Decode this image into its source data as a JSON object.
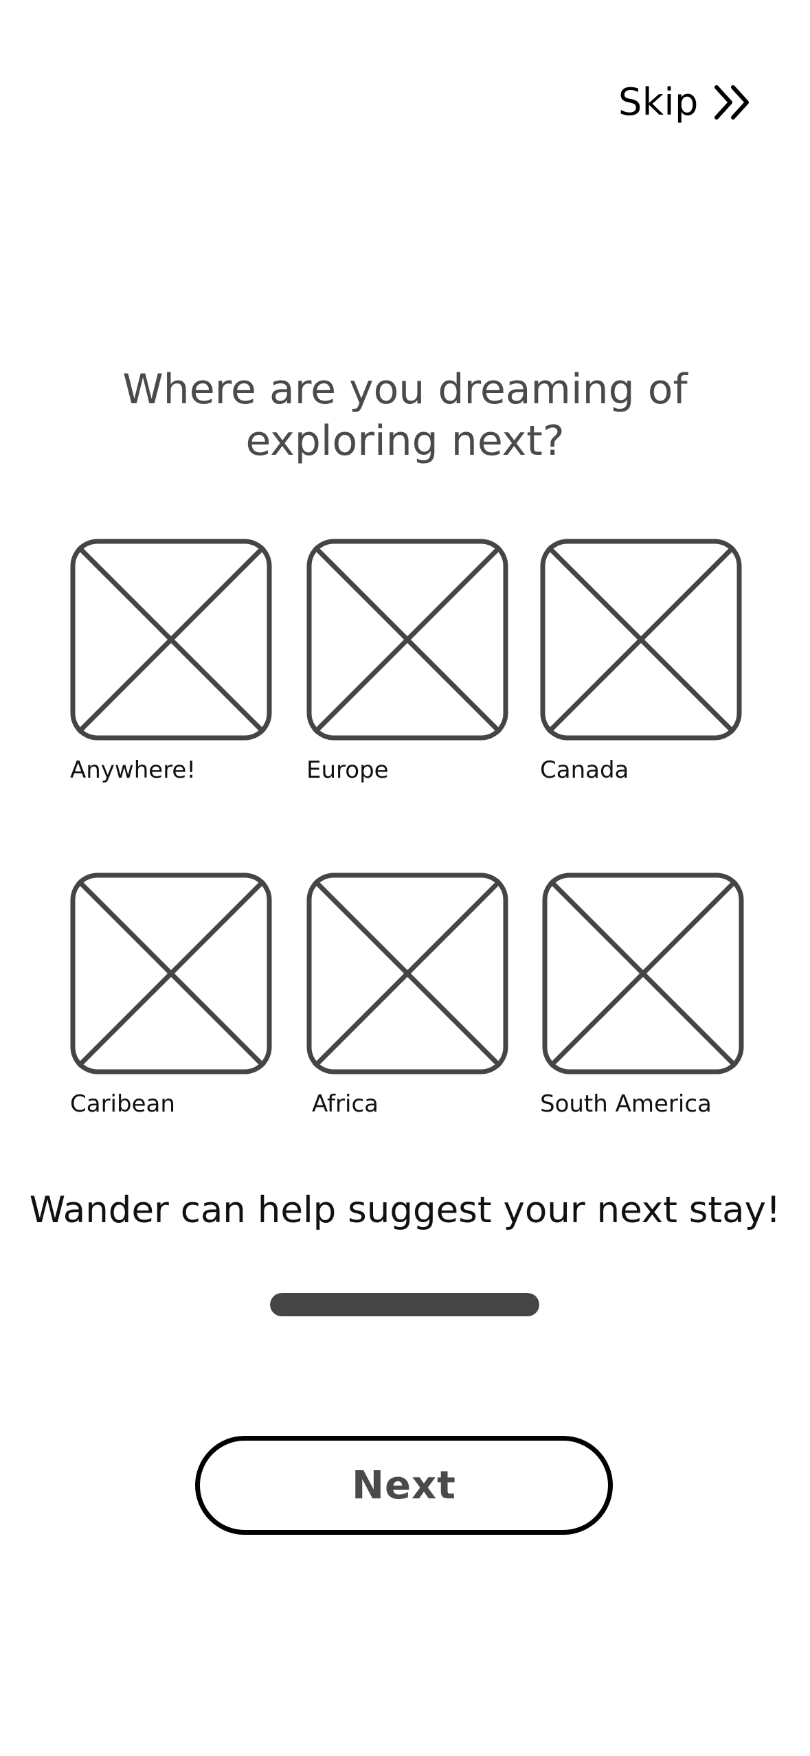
{
  "header": {
    "skip_label": "Skip",
    "skip_icon": "double-chevron-right-icon"
  },
  "prompt": {
    "heading_line1": "Where are you dreaming of",
    "heading_line2": "exploring next?"
  },
  "options": [
    {
      "label": "Anywhere!",
      "icon": "image-placeholder-icon"
    },
    {
      "label": "Europe",
      "icon": "image-placeholder-icon"
    },
    {
      "label": "Canada",
      "icon": "image-placeholder-icon"
    },
    {
      "label": "Caribean",
      "icon": "image-placeholder-icon"
    },
    {
      "label": "Africa",
      "icon": "image-placeholder-icon"
    },
    {
      "label": "South America",
      "icon": "image-placeholder-icon"
    }
  ],
  "message": "Wander can help suggest your next stay!",
  "progress": {
    "fraction": 1.0,
    "fill_color": "#454545"
  },
  "footer": {
    "next_label": "Next"
  },
  "colors": {
    "stroke": "#454545",
    "heading": "#4a4a4a"
  }
}
